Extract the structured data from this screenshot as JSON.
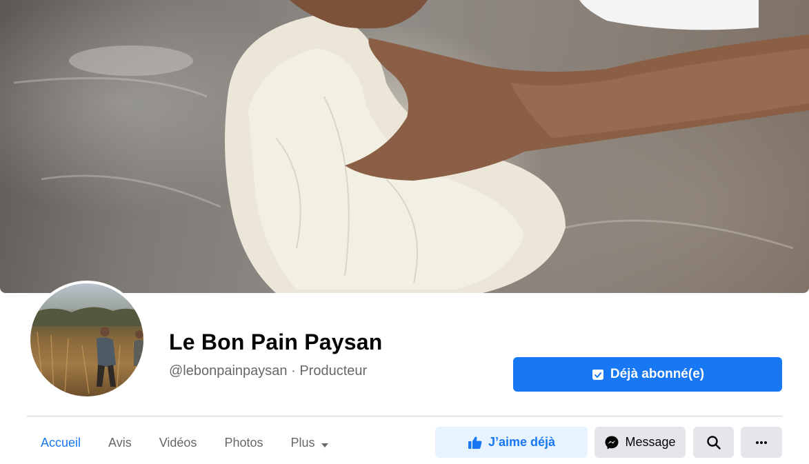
{
  "page": {
    "name": "Le Bon Pain Paysan",
    "handle": "@lebonpainpaysan",
    "separator": " · ",
    "category": "Producteur"
  },
  "cover": {
    "subject": "hands kneading bread dough on a floured table"
  },
  "avatar": {
    "subject": "farmers in a wheat field"
  },
  "subscribe_button": {
    "label": "Déjà abonné(e)",
    "icon": "calendar-check-icon"
  },
  "tabs": [
    {
      "label": "Accueil",
      "active": true
    },
    {
      "label": "Avis",
      "active": false
    },
    {
      "label": "Vidéos",
      "active": false
    },
    {
      "label": "Photos",
      "active": false
    },
    {
      "label": "Plus",
      "active": false,
      "icon": "caret-down-icon"
    }
  ],
  "actions": {
    "like_label": "J’aime déjà",
    "message_label": "Message",
    "search_icon": "search-icon",
    "more_icon": "more-horizontal-icon"
  },
  "colors": {
    "accent": "#1877f2",
    "accent_light": "#e7f3ff",
    "button_grey": "#e4e6eb",
    "secondary_text": "#65676b"
  }
}
